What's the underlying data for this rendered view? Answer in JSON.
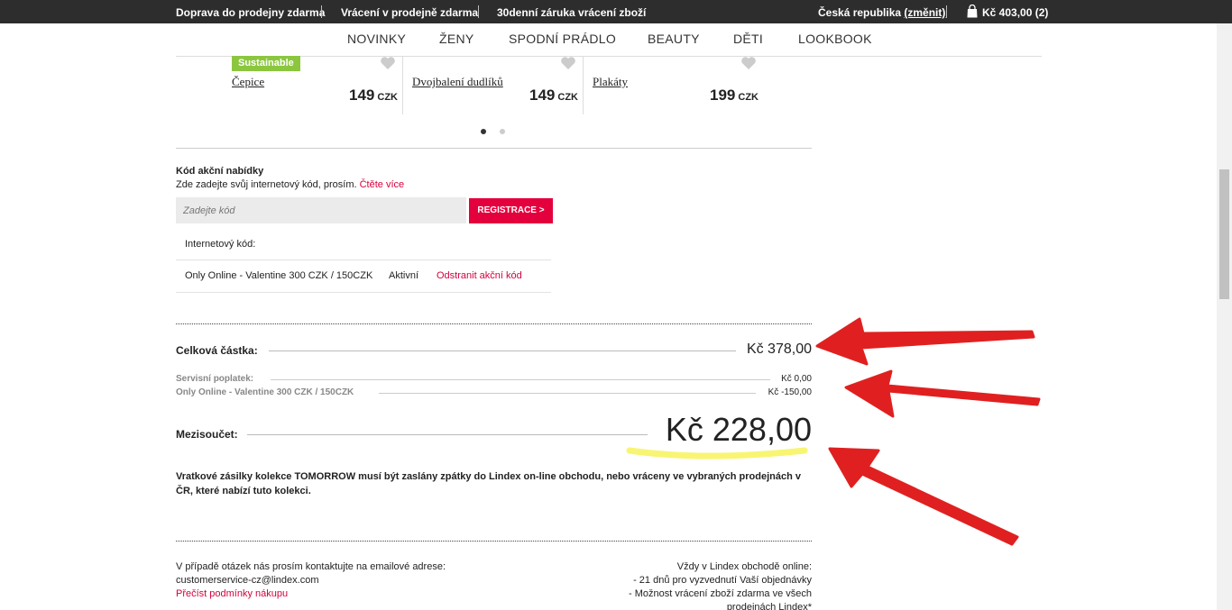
{
  "topbar": {
    "shipping": "Doprava do prodejny zdarma",
    "returns": "Vrácení v prodejně zdarma",
    "guarantee": "30denní záruka vrácení zboží",
    "country": "Česká republika",
    "change": "(změnit)",
    "cart": "Kč 403,00 (2)"
  },
  "nav": {
    "items": [
      "NOVINKY",
      "ŽENY",
      "SPODNÍ PRÁDLO",
      "BEAUTY",
      "DĚTI",
      "LOOKBOOK"
    ]
  },
  "products": [
    {
      "badge": "Sustainable",
      "name": "Čepice",
      "price": "149",
      "currency": "CZK"
    },
    {
      "badge": "",
      "name": "Dvojbalení dudlíků",
      "price": "149",
      "currency": "CZK"
    },
    {
      "badge": "",
      "name": "Plakáty",
      "price": "199",
      "currency": "CZK"
    }
  ],
  "carousel": {
    "pages": 2,
    "active": 1
  },
  "promo": {
    "title": "Kód akční nabídky",
    "subtitle": "Zde zadejte svůj internetový kód, prosím.",
    "read_more": "Čtěte více",
    "placeholder": "Zadejte kód",
    "button": "REGISTRACE >",
    "code_label": "Internetový kód:",
    "code_name": "Only Online - Valentine 300 CZK / 150CZK",
    "code_status": "Aktivní",
    "code_remove": "Odstranit akční kód"
  },
  "totals": {
    "total_label": "Celková částka:",
    "total_value": "Kč 378,00",
    "fee_label": "Servisní poplatek:",
    "fee_value": "Kč 0,00",
    "discount_label": "Only Online - Valentine 300 CZK / 150CZK",
    "discount_value": "Kč -150,00",
    "subtotal_label": "Mezisoučet:",
    "subtotal_value": "Kč 228,00"
  },
  "note": "Vratkové zásilky kolekce TOMORROW musí být zaslány zpátky do Lindex on-line obchodu, nebo vráceny ve vybraných prodejnách v ČR, které nabízí tuto kolekci.",
  "footer": {
    "left_line1": "V případě otázek nás prosím kontaktujte na emailové adrese:",
    "left_email": "customerservice-cz@lindex.com",
    "left_link": "Přečíst podmínky nákupu",
    "right_line1": "Vždy v Lindex obchodě online:",
    "right_line2": "- 21 dnů pro vyzvednutí Vaší objednávky",
    "right_line3": "- Možnost vrácení zboží zdarma ve všech",
    "right_line4": "prodejnách Lindex*"
  },
  "colors": {
    "accent": "#e4003c",
    "sustainable": "#8cc63f",
    "annotation_arrow": "#e02020",
    "annotation_highlight": "#f7f35a"
  }
}
